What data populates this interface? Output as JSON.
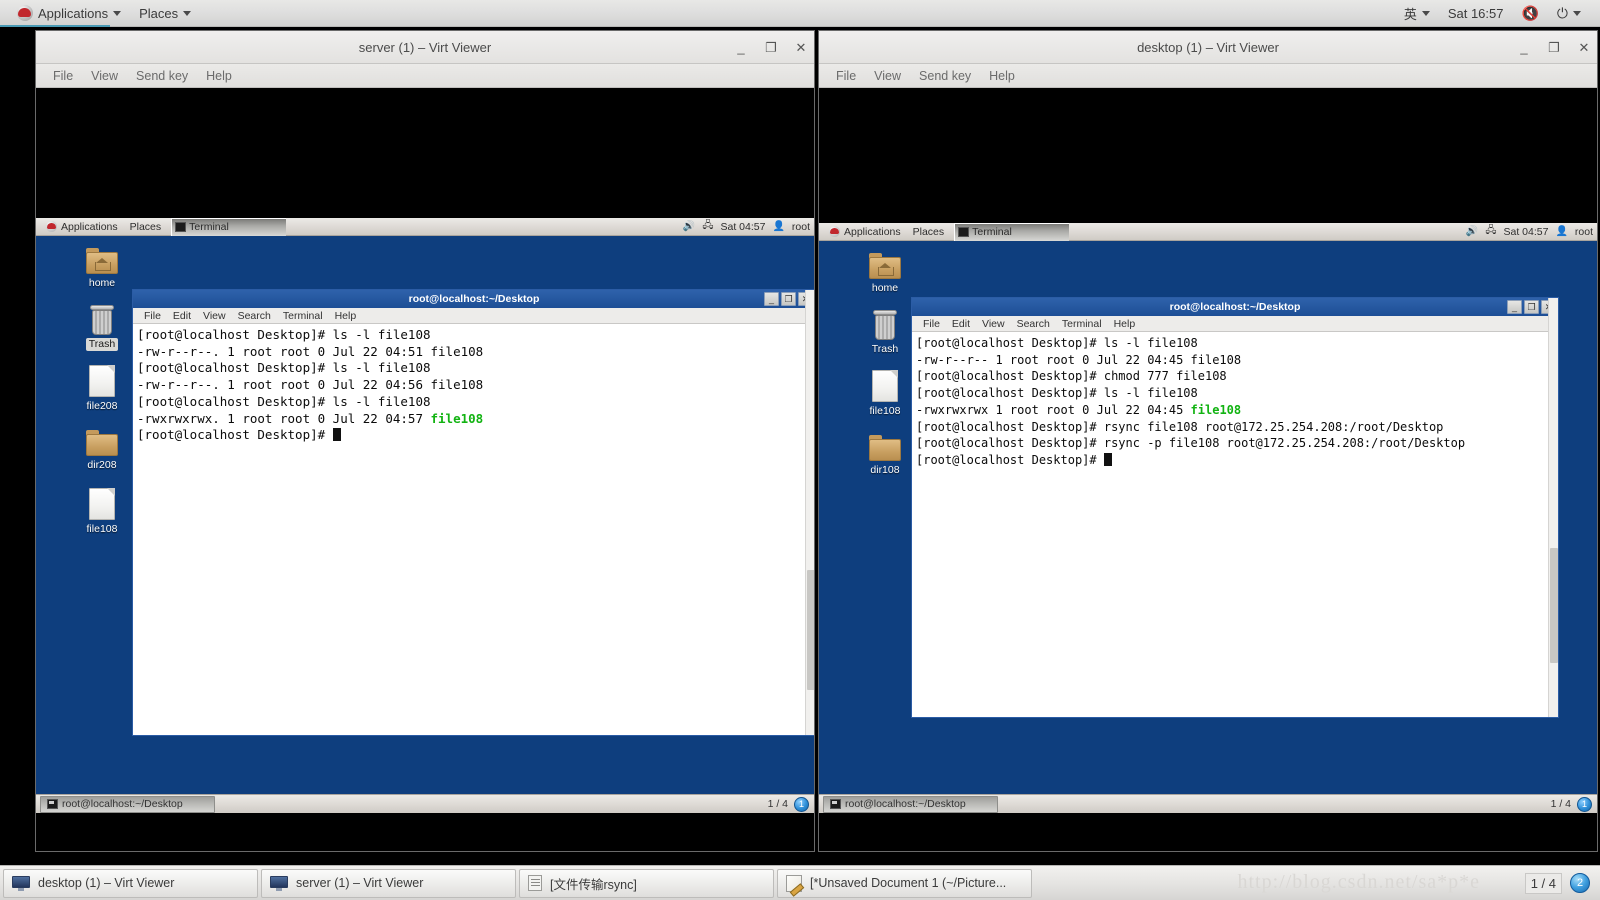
{
  "host": {
    "top_panel": {
      "applications_label": "Applications",
      "places_label": "Places",
      "input_method": "英",
      "clock": "Sat 16:57",
      "volume_icon": "speaker-muted-icon",
      "power_icon": "power-icon"
    },
    "taskbar": {
      "items": [
        {
          "label": "desktop (1) – Virt Viewer",
          "icon": "monitor-icon"
        },
        {
          "label": "server (1) – Virt Viewer",
          "icon": "monitor-icon"
        },
        {
          "label": "[文件传输rsync]",
          "icon": "document-icon"
        },
        {
          "label": "[*Unsaved Document 1 (~/Picture...",
          "icon": "notepad-icon"
        }
      ],
      "workspace_indicator": "1 / 4",
      "workspace_badge": "2",
      "watermark": "http://blog.csdn.net/sa*p*e"
    }
  },
  "windows": [
    {
      "id": "server",
      "title": "server (1) – Virt Viewer",
      "menu": [
        "File",
        "View",
        "Send key",
        "Help"
      ],
      "buttons": {
        "minimize": "_",
        "maximize": "❐",
        "close": "✕"
      },
      "guest": {
        "top_panel": {
          "applications_label": "Applications",
          "places_label": "Places",
          "task_label": "Terminal",
          "clock": "Sat 04:57",
          "user": "root"
        },
        "desktop_icons": [
          {
            "label": "home",
            "type": "folder-home",
            "selected": false
          },
          {
            "label": "Trash",
            "type": "trash",
            "selected": true
          },
          {
            "label": "file208",
            "type": "file",
            "selected": false
          },
          {
            "label": "dir208",
            "type": "folder",
            "selected": false
          },
          {
            "label": "file108",
            "type": "file",
            "selected": false
          }
        ],
        "terminal": {
          "title": "root@localhost:~/Desktop",
          "menu": [
            "File",
            "Edit",
            "View",
            "Search",
            "Terminal",
            "Help"
          ],
          "buttons": {
            "minimize": "_",
            "maximize": "❐",
            "close": "✕"
          },
          "lines": [
            [
              {
                "t": "[root@localhost Desktop]# ls -l file108",
                "c": "plain"
              }
            ],
            [
              {
                "t": "-rw-r--r--. 1 root root 0 Jul 22 04:51 file108",
                "c": "plain"
              }
            ],
            [
              {
                "t": "[root@localhost Desktop]# ls -l file108",
                "c": "plain"
              }
            ],
            [
              {
                "t": "-rw-r--r--. 1 root root 0 Jul 22 04:56 file108",
                "c": "plain"
              }
            ],
            [
              {
                "t": "[root@localhost Desktop]# ls -l file108",
                "c": "plain"
              }
            ],
            [
              {
                "t": "-rwxrwxrwx. 1 root root 0 Jul 22 04:57 ",
                "c": "plain"
              },
              {
                "t": "file108",
                "c": "green"
              }
            ],
            [
              {
                "t": "[root@localhost Desktop]# ",
                "c": "plain"
              },
              {
                "t": "",
                "c": "cursor"
              }
            ]
          ]
        },
        "bottom_panel": {
          "task_label": "root@localhost:~/Desktop",
          "workspace_indicator": "1 / 4",
          "workspace_badge": "1"
        }
      }
    },
    {
      "id": "desktop",
      "title": "desktop (1) – Virt Viewer",
      "menu": [
        "File",
        "View",
        "Send key",
        "Help"
      ],
      "buttons": {
        "minimize": "_",
        "maximize": "❐",
        "close": "✕"
      },
      "guest": {
        "top_panel": {
          "applications_label": "Applications",
          "places_label": "Places",
          "task_label": "Terminal",
          "clock": "Sat 04:57",
          "user": "root"
        },
        "desktop_icons": [
          {
            "label": "home",
            "type": "folder-home",
            "selected": false
          },
          {
            "label": "Trash",
            "type": "trash",
            "selected": false
          },
          {
            "label": "file108",
            "type": "file",
            "selected": false
          },
          {
            "label": "dir108",
            "type": "folder",
            "selected": false
          }
        ],
        "terminal": {
          "title": "root@localhost:~/Desktop",
          "menu": [
            "File",
            "Edit",
            "View",
            "Search",
            "Terminal",
            "Help"
          ],
          "buttons": {
            "minimize": "_",
            "maximize": "❐",
            "close": "✕"
          },
          "lines": [
            [
              {
                "t": "[root@localhost Desktop]# ls -l file108",
                "c": "plain"
              }
            ],
            [
              {
                "t": "-rw-r--r-- 1 root root 0 Jul 22 04:45 file108",
                "c": "plain"
              }
            ],
            [
              {
                "t": "[root@localhost Desktop]# chmod 777 file108",
                "c": "plain"
              }
            ],
            [
              {
                "t": "[root@localhost Desktop]# ls -l file108",
                "c": "plain"
              }
            ],
            [
              {
                "t": "-rwxrwxrwx 1 root root 0 Jul 22 04:45 ",
                "c": "plain"
              },
              {
                "t": "file108",
                "c": "green"
              }
            ],
            [
              {
                "t": "[root@localhost Desktop]# rsync file108 root@172.25.254.208:/root/Desktop",
                "c": "plain"
              }
            ],
            [
              {
                "t": "[root@localhost Desktop]# rsync -p file108 root@172.25.254.208:/root/Desktop",
                "c": "plain"
              }
            ],
            [
              {
                "t": "[root@localhost Desktop]# ",
                "c": "plain"
              },
              {
                "t": "",
                "c": "cursor"
              }
            ]
          ]
        },
        "bottom_panel": {
          "task_label": "root@localhost:~/Desktop",
          "workspace_indicator": "1 / 4",
          "workspace_badge": "1"
        }
      }
    }
  ],
  "colors": {
    "guest_desktop_blue": "#0e3e7e",
    "terminal_title_blue": "#1d4e95",
    "terminal_green": "#12b312",
    "panel_grey": "#ddd9d4"
  }
}
